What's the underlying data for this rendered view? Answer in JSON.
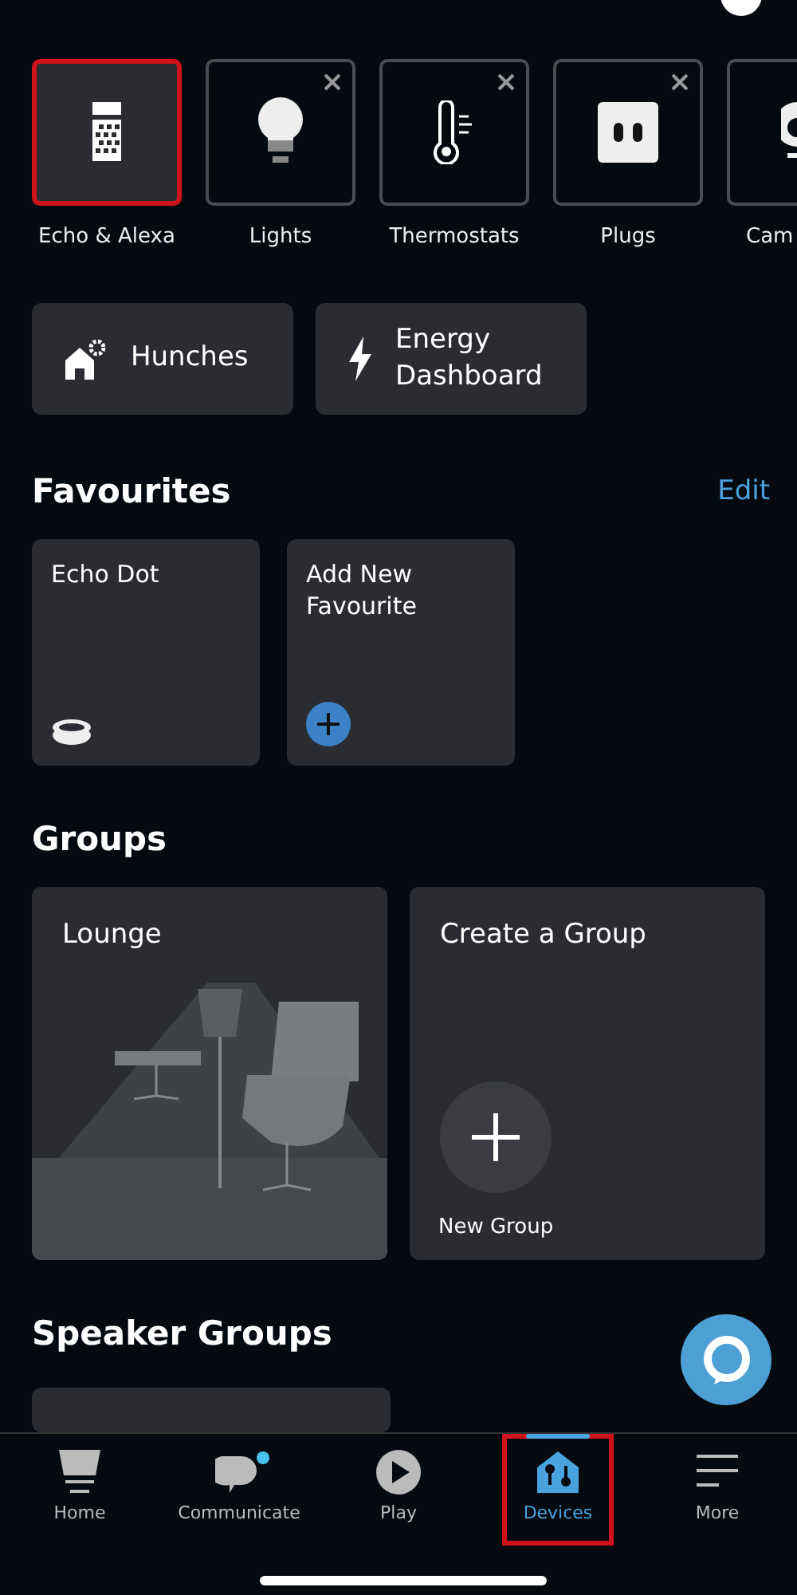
{
  "categories": [
    {
      "label": "Echo & Alexa",
      "kind": "speaker",
      "selected": true,
      "highlighted": true,
      "removable": false
    },
    {
      "label": "Lights",
      "kind": "bulb",
      "selected": false,
      "highlighted": false,
      "removable": true
    },
    {
      "label": "Thermostats",
      "kind": "thermometer",
      "selected": false,
      "highlighted": false,
      "removable": true
    },
    {
      "label": "Plugs",
      "kind": "plug",
      "selected": false,
      "highlighted": false,
      "removable": true
    },
    {
      "label": "Cam",
      "kind": "camera",
      "selected": false,
      "highlighted": false
    }
  ],
  "actions": [
    {
      "label": "Hunches",
      "kind": "hunches"
    },
    {
      "label": "Energy Dashboard",
      "kind": "energy"
    }
  ],
  "favourites": {
    "title": "Favourites",
    "edit": "Edit",
    "items": [
      {
        "label": "Echo Dot",
        "kind": "device"
      },
      {
        "label": "Add New Favourite",
        "kind": "add"
      }
    ]
  },
  "groups": {
    "title": "Groups",
    "items": [
      {
        "label": "Lounge",
        "kind": "picture"
      },
      {
        "label": "Create a Group",
        "kind": "create",
        "button": "New Group"
      }
    ]
  },
  "speaker_groups": {
    "title": "Speaker Groups"
  },
  "tabs": [
    {
      "label": "Home",
      "kind": "home",
      "selected": false,
      "highlighted": false,
      "badge": false
    },
    {
      "label": "Communicate",
      "kind": "chat",
      "selected": false,
      "highlighted": false,
      "badge": true
    },
    {
      "label": "Play",
      "kind": "play",
      "selected": false,
      "highlighted": false,
      "badge": false
    },
    {
      "label": "Devices",
      "kind": "devices",
      "selected": true,
      "highlighted": true,
      "badge": false
    },
    {
      "label": "More",
      "kind": "more",
      "selected": false,
      "highlighted": false,
      "badge": false
    }
  ]
}
